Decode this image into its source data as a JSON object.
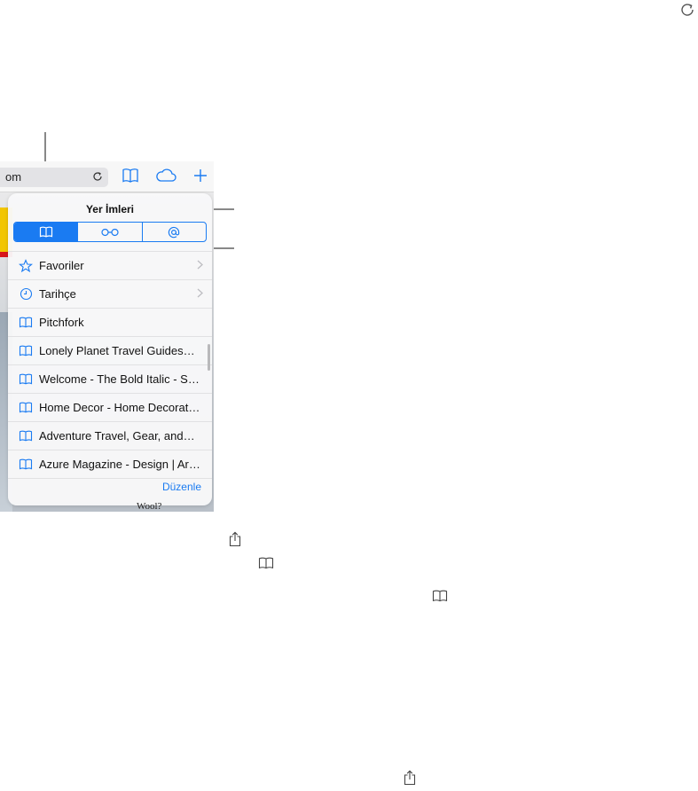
{
  "popover": {
    "title": "Yer İmleri",
    "segments": [
      {
        "icon": "book-icon",
        "selected": true
      },
      {
        "icon": "glasses-icon",
        "selected": false
      },
      {
        "icon": "at-icon",
        "selected": false
      }
    ],
    "items": [
      {
        "label": "Favoriler",
        "icon": "star-icon",
        "has_chevron": true
      },
      {
        "label": "Tarihçe",
        "icon": "clock-icon",
        "has_chevron": true
      },
      {
        "label": "Pitchfork",
        "icon": "book-icon"
      },
      {
        "label": "Lonely Planet Travel Guides…",
        "icon": "book-icon"
      },
      {
        "label": "Welcome - The Bold Italic - S…",
        "icon": "book-icon"
      },
      {
        "label": "Home Decor - Home Decorat…",
        "icon": "book-icon"
      },
      {
        "label": "Adventure Travel, Gear, and…",
        "icon": "book-icon"
      },
      {
        "label": "Azure Magazine - Design | Ar…",
        "icon": "book-icon"
      }
    ],
    "edit_label": "Düzenle"
  },
  "toolbar": {
    "url_text": "om"
  },
  "background": {
    "caption": "Wool?"
  },
  "colors": {
    "accent": "#1a7bf2",
    "icon_gray": "#8e8e93"
  }
}
